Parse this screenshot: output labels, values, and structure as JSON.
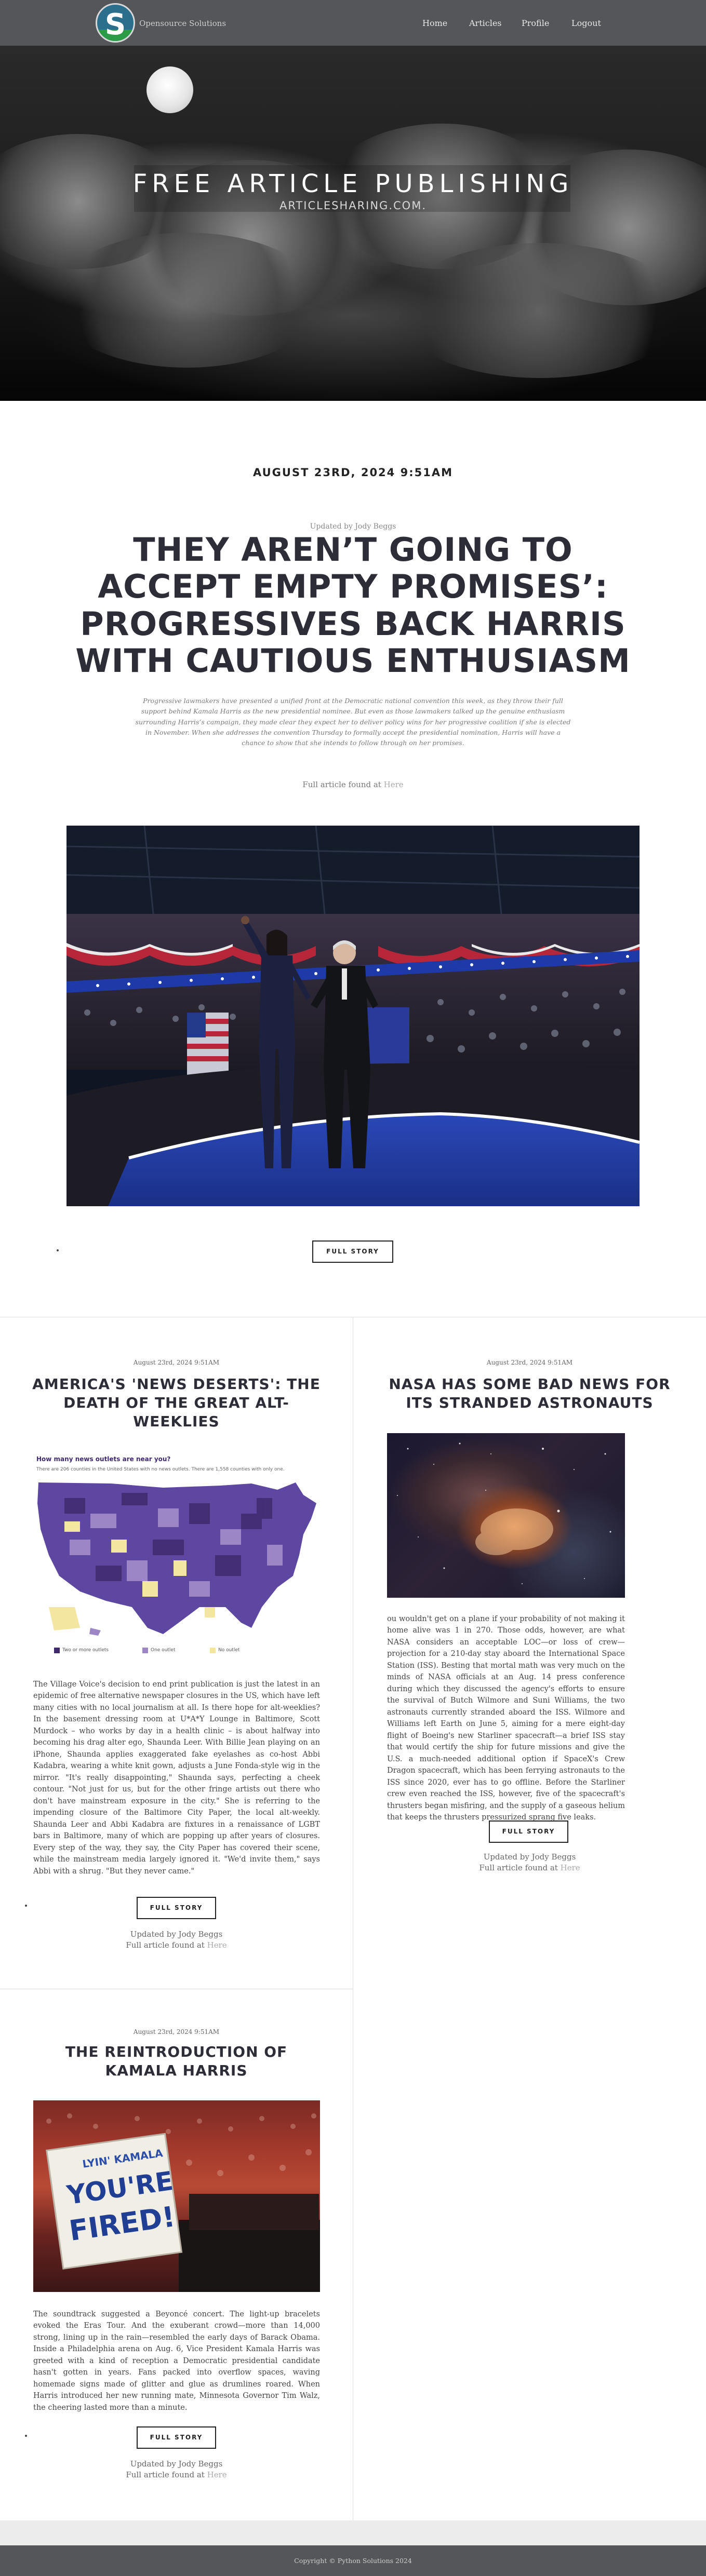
{
  "header": {
    "brand": "Opensource Solutions",
    "logo_letter": "S",
    "nav": [
      "Home",
      "Articles",
      "Profile",
      "Logout"
    ]
  },
  "hero": {
    "title": "FREE ARTICLE PUBLISHING",
    "subtitle": "ARTICLESHARING.COM."
  },
  "featured": {
    "date": "AUGUST 23RD, 2024 9:51AM",
    "updated_by": "Updated by Jody Beggs",
    "title": "THEY AREN’T GOING TO ACCEPT EMPTY PROMISES’: PROGRESSIVES BACK HARRIS WITH CAUTIOUS ENTHUSIASM",
    "summary": "Progressive lawmakers have presented a unified front at the Democratic national convention this week, as they throw their full support behind Kamala Harris as the new presidential nominee. But even as those lawmakers talked up the genuine enthusiasm surrounding Harris’s campaign, they made clear they expect her to deliver policy wins for her progressive coalition if she is elected in November. When she addresses the convention Thursday to formally accept the presidential nomination, Harris will have a chance to show that she intends to follow through on her promises.",
    "full_article_prefix": "Full article found at",
    "full_article_link": "Here",
    "button": "FULL STORY"
  },
  "cards": [
    {
      "date": "August 23rd, 2024 9:51AM",
      "title": "AMERICA'S 'NEWS DESERTS': THE DEATH OF THE GREAT ALT-WEEKLIES",
      "map": {
        "title": "How many news outlets are near you?",
        "caption": "There are 206 counties in the United States with no news outlets. There are 1,558 counties with only one.",
        "legend": [
          "Two or more outlets",
          "One outlet",
          "No outlet"
        ],
        "colors": [
          "#3f2a6e",
          "#9c86c6",
          "#f3e6a0"
        ]
      },
      "body": "The Village Voice's decision to end print publication is just the latest in an epidemic of free alternative newspaper closures in the US, which have left many cities with no local journalism at all. Is there hope for alt-weeklies? In the basement dressing room at U*A*Y Lounge in Baltimore, Scott Murdock – who works by day in a health clinic – is about halfway into becoming his drag alter ego, Shaunda Leer. With Billie Jean playing on an iPhone, Shaunda applies exaggerated fake eyelashes as co-host Abbi Kadabra, wearing a white knit gown, adjusts a June Fonda-style wig in the mirror. \"It's really disappointing,\" Shaunda says, perfecting a cheek contour. \"Not just for us, but for the other fringe artists out there who don't have mainstream exposure in the city.\" She is referring to the impending closure of the Baltimore City Paper, the local alt-weekly. Shaunda Leer and Abbi Kadabra are fixtures in a renaissance of LGBT bars in Baltimore, many of which are popping up after years of closures. Every step of the way, they say, the City Paper has covered their scene, while the mainstream media largely ignored it. \"We'd invite them,\" says Abbi with a shrug. \"But they never came.\"",
      "button": "FULL STORY",
      "updated_by": "Updated by Jody Beggs",
      "full_article_prefix": "Full article found at",
      "full_article_link": "Here"
    },
    {
      "date": "August 23rd, 2024 9:51AM",
      "title": "NASA HAS SOME BAD NEWS FOR ITS STRANDED ASTRONAUTS",
      "body": "ou wouldn't get on a plane if your probability of not making it home alive was 1 in 270. Those odds, however, are what NASA considers an acceptable LOC—or loss of crew—projection for a 210-day stay aboard the International Space Station (ISS). Besting that mortal math was very much on the minds of NASA officials at an Aug. 14 press conference during which they discussed the agency's efforts to ensure the survival of Butch Wilmore and Suni Williams, the two astronauts currently stranded aboard the ISS. Wilmore and Williams left Earth on June 5, aiming for a mere eight-day flight of Boeing's new Starliner spacecraft—a brief ISS stay that would certify the ship for future missions and give the U.S. a much-needed additional option if SpaceX's Crew Dragon spacecraft, which has been ferrying astronauts to the ISS since 2020, ever has to go offline. Before the Starliner crew even reached the ISS, however, five of the spacecraft's thrusters began misfiring, and the supply of a gaseous helium that keeps the thrusters pressurized sprang five leaks.",
      "button": "FULL STORY",
      "updated_by": "Updated by Jody Beggs",
      "full_article_prefix": "Full article found at",
      "full_article_link": "Here"
    },
    {
      "date": "August 23rd, 2024 9:51AM",
      "title": "THE REINTRODUCTION OF KAMALA HARRIS",
      "sign_lines": [
        "LYIN' KAMALA",
        "YOU'RE",
        "FIRED!"
      ],
      "body": "The soundtrack suggested a Beyoncé concert. The light-up bracelets evoked the Eras Tour. And the exuberant crowd—more than 14,000 strong, lining up in the rain—resembled the early days of Barack Obama. Inside a Philadelphia arena on Aug. 6, Vice President Kamala Harris was greeted with a kind of reception a Democratic presidential candidate hasn't gotten in years. Fans packed into overflow spaces, waving homemade signs made of glitter and glue as drumlines roared. When Harris introduced her new running mate, Minnesota Governor Tim Walz, the cheering lasted more than a minute.",
      "button": "FULL STORY",
      "updated_by": "Updated by Jody Beggs",
      "full_article_prefix": "Full article found at",
      "full_article_link": "Here"
    }
  ],
  "footer": {
    "copyright": "Copyright © Python Solutions 2024"
  }
}
